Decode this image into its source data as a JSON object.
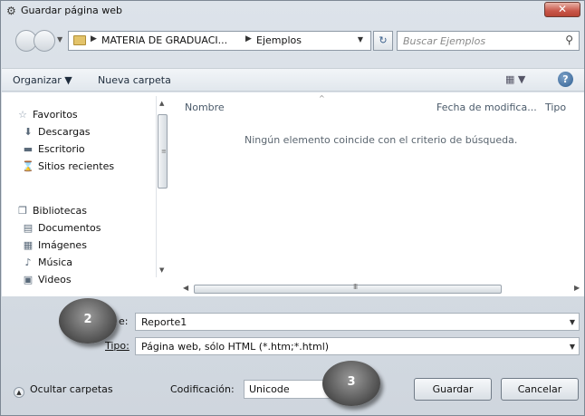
{
  "window": {
    "title": "Guardar página web",
    "close_glyph": "✕"
  },
  "nav": {
    "breadcrumb": [
      "MATERIA DE GRADUACI...",
      "Ejemplos"
    ],
    "search_placeholder": "Buscar Ejemplos"
  },
  "toolbar": {
    "organize": "Organizar ▼",
    "new_folder": "Nueva carpeta",
    "help": "?"
  },
  "sidebar": {
    "favorites": "Favoritos",
    "items": [
      "Descargas",
      "Escritorio",
      "Sitios recientes"
    ],
    "libraries": "Bibliotecas",
    "library_items": [
      "Documentos",
      "Imágenes",
      "Música",
      "Videos"
    ]
  },
  "list": {
    "columns": [
      "Nombre",
      "Fecha de modifica...",
      "Tipo"
    ],
    "empty_message": "Ningún elemento coincide con el criterio de búsqueda."
  },
  "form": {
    "filename_label": "e:",
    "filename_value": "Reporte1",
    "type_label": "Tipo:",
    "type_value": "Página web, sólo HTML (*.htm;*.html)"
  },
  "footer": {
    "hide_folders": "Ocultar carpetas",
    "encoding_label": "Codificación:",
    "encoding_value": "Unicode",
    "save": "Guardar",
    "cancel": "Cancelar"
  },
  "markers": [
    "2",
    "3"
  ]
}
